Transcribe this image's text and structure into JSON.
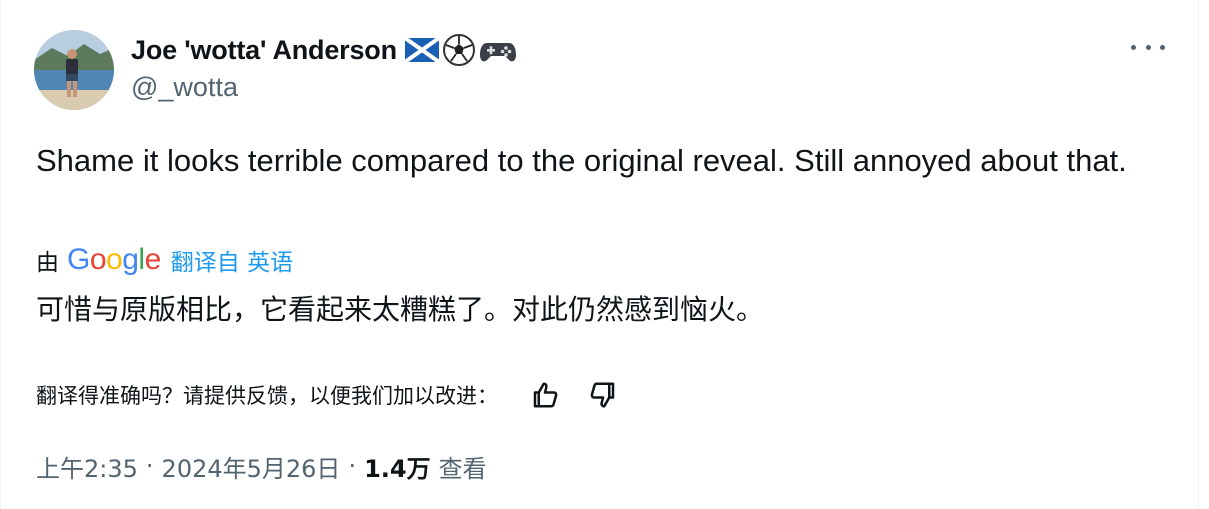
{
  "author": {
    "name": "Joe 'wotta' Anderson",
    "handle": "@_wotta",
    "emojis": [
      "scotland-flag-icon",
      "soccer-ball-icon",
      "game-controller-icon"
    ]
  },
  "tweet": {
    "text": "Shame it looks terrible compared to the original reveal. Still annoyed about that."
  },
  "translation": {
    "by_label": "由",
    "provider": "Google",
    "translate_link": "翻译自 英语",
    "text": "可惜与原版相比，它看起来太糟糕了。对此仍然感到恼火。",
    "feedback_question": "翻译得准确吗？请提供反馈，以便我们加以改进："
  },
  "meta": {
    "time": "上午2:35",
    "separator": "·",
    "date": "2024年5月26日",
    "views_count": "1.4万",
    "views_label": "查看"
  },
  "colors": {
    "text": "#0f1419",
    "secondary": "#536471",
    "link": "#1d9bf0"
  }
}
